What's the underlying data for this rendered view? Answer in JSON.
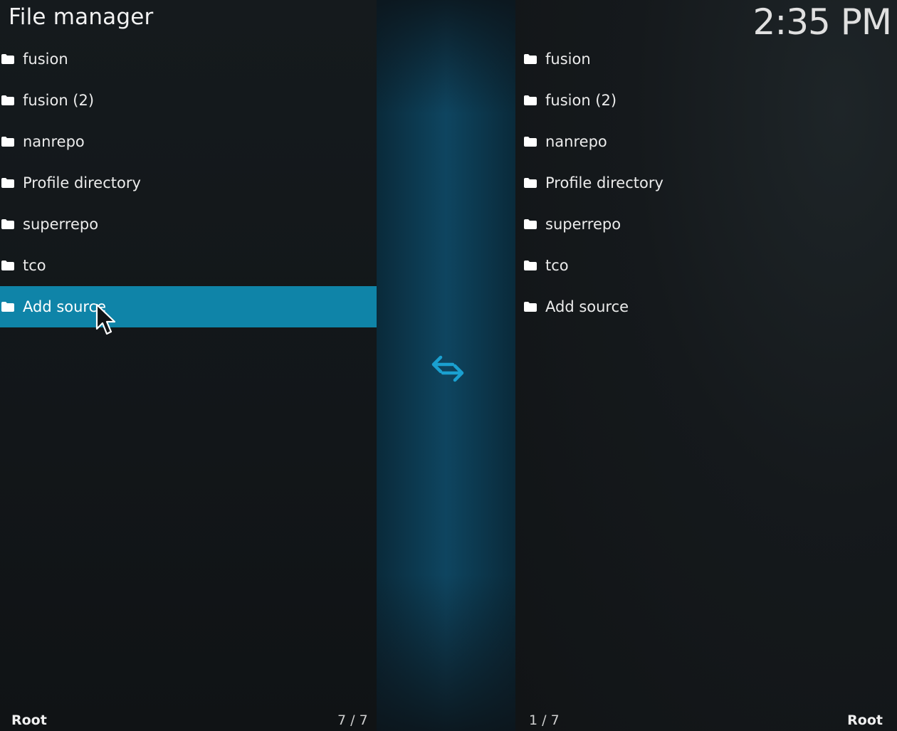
{
  "header": {
    "title": "File manager",
    "clock": "2:35 PM"
  },
  "left_pane": {
    "items": [
      {
        "label": "fusion",
        "icon": "folder-icon"
      },
      {
        "label": "fusion (2)",
        "icon": "folder-icon"
      },
      {
        "label": "nanrepo",
        "icon": "folder-icon"
      },
      {
        "label": "Profile directory",
        "icon": "folder-icon"
      },
      {
        "label": "superrepo",
        "icon": "folder-icon"
      },
      {
        "label": "tco",
        "icon": "folder-icon"
      },
      {
        "label": "Add source",
        "icon": "folder-icon",
        "selected": true
      }
    ],
    "footer_path": "Root",
    "footer_count": "7 / 7"
  },
  "right_pane": {
    "items": [
      {
        "label": "fusion",
        "icon": "folder-icon"
      },
      {
        "label": "fusion (2)",
        "icon": "folder-icon"
      },
      {
        "label": "nanrepo",
        "icon": "folder-icon"
      },
      {
        "label": "Profile directory",
        "icon": "folder-icon"
      },
      {
        "label": "superrepo",
        "icon": "folder-icon"
      },
      {
        "label": "tco",
        "icon": "folder-icon"
      },
      {
        "label": "Add source",
        "icon": "folder-icon"
      }
    ],
    "footer_path": "Root",
    "footer_count": "1 / 7"
  },
  "swap_icon": "swap-arrows-icon",
  "colors": {
    "selection": "#0f84a8",
    "accent": "#1aa0d0",
    "divider": "#0e4560"
  }
}
